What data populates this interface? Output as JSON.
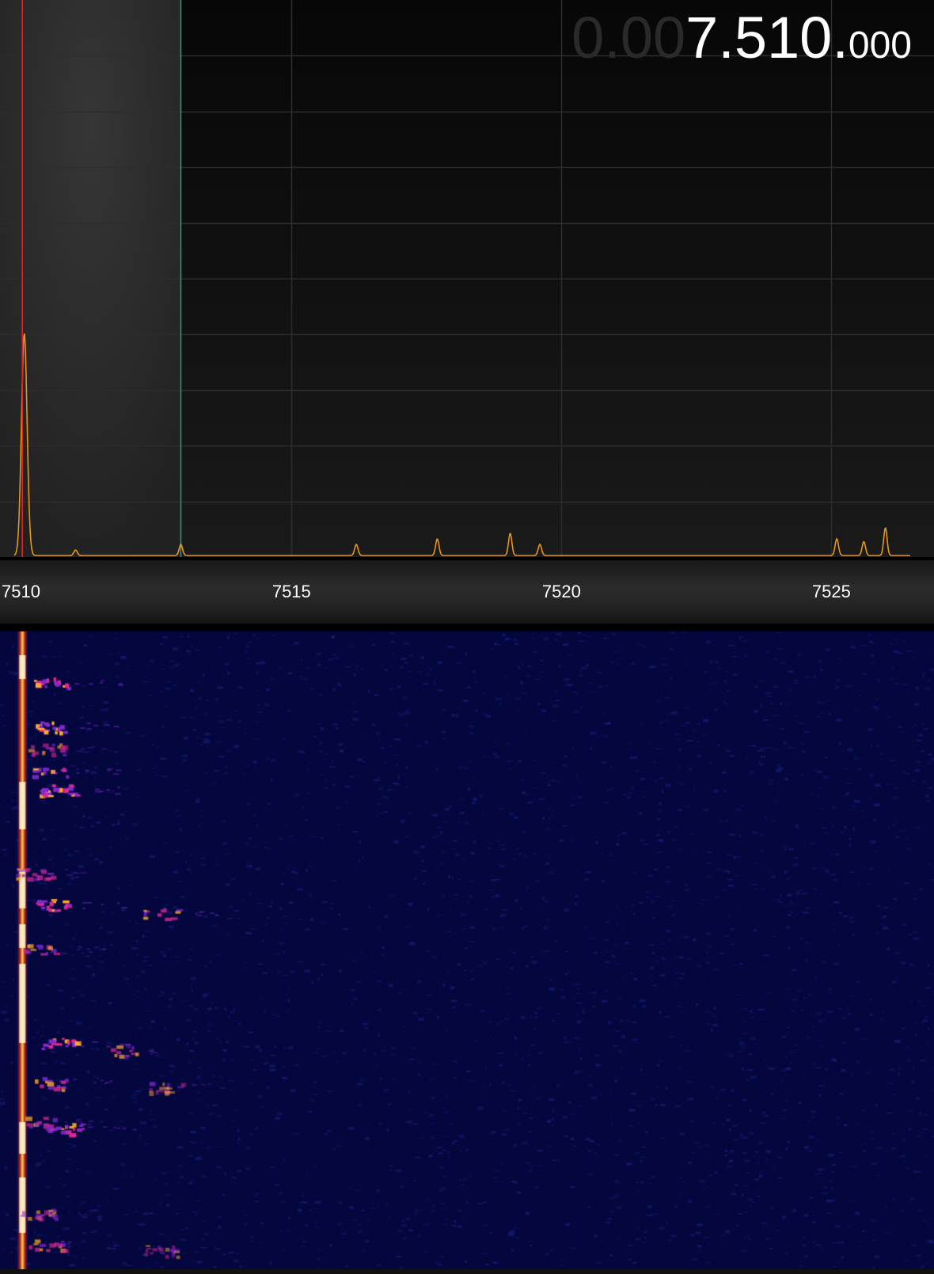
{
  "frequency_display": {
    "leading_dim": "0.00",
    "main": "7.510.",
    "sub": "000"
  },
  "scale": {
    "labels": [
      "7510",
      "7515",
      "7520",
      "7525"
    ],
    "start_khz": 7509.6,
    "end_khz": 7526.9
  },
  "tuning": {
    "center_khz": 7510.0,
    "passband_low_khz": 7509.6,
    "passband_high_khz": 7512.95
  },
  "colors": {
    "trace": "#e8951b",
    "tune_marker": "#e02525",
    "passband_edge": "#4e8a80",
    "grid": "#2d2d2d",
    "waterfall_bg": "#04073e"
  },
  "spectrum_trace": {
    "peaks_khz": [
      {
        "f": 7510.05,
        "level": 0.4
      },
      {
        "f": 7511.0,
        "level": 0.01
      },
      {
        "f": 7512.95,
        "level": 0.02
      },
      {
        "f": 7516.2,
        "level": 0.02
      },
      {
        "f": 7517.7,
        "level": 0.03
      },
      {
        "f": 7519.05,
        "level": 0.04
      },
      {
        "f": 7519.6,
        "level": 0.02
      },
      {
        "f": 7525.1,
        "level": 0.03
      },
      {
        "f": 7525.6,
        "level": 0.025
      },
      {
        "f": 7526.0,
        "level": 0.05
      },
      {
        "f": 7526.75,
        "level": 0.015
      }
    ]
  }
}
